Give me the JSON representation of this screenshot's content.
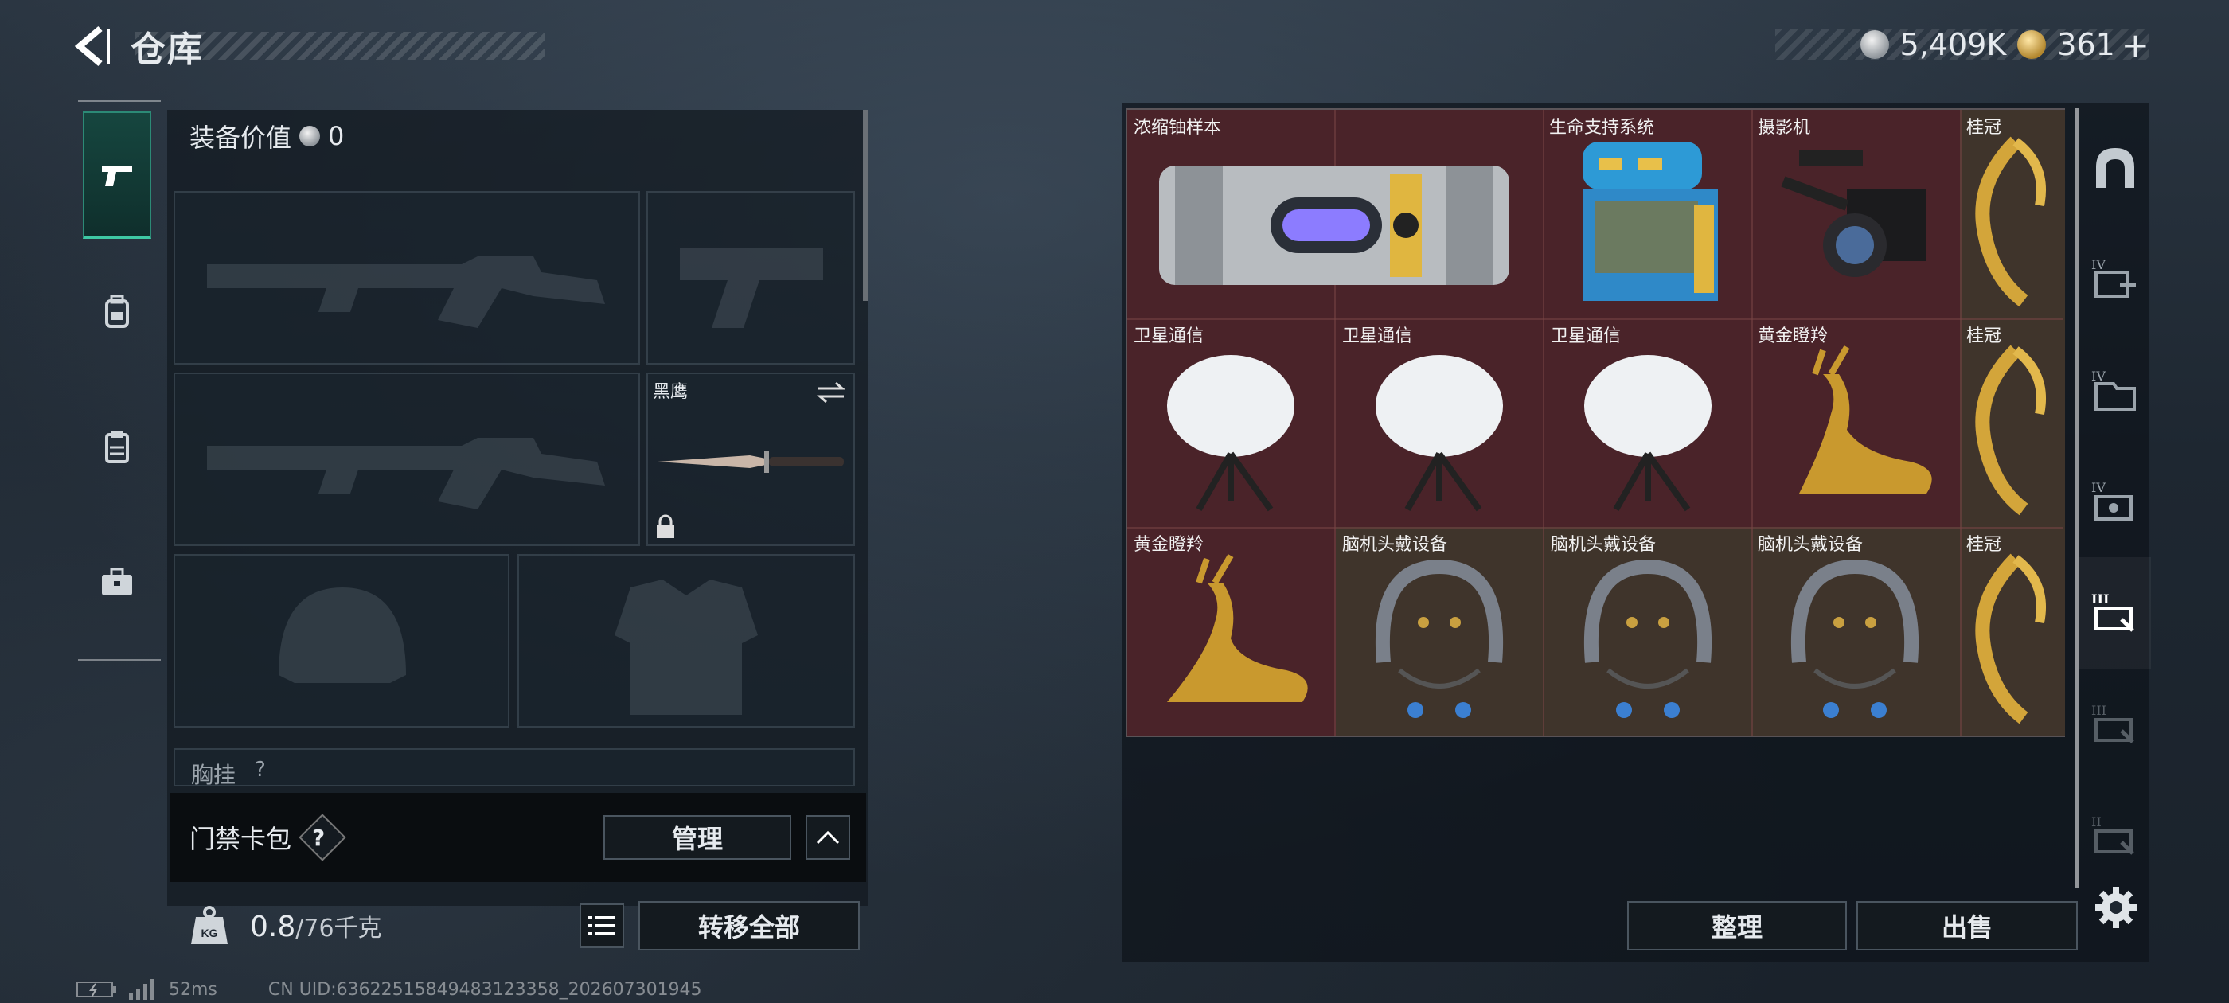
{
  "header": {
    "title": "仓库",
    "currency": [
      {
        "icon": "silver-coin-icon",
        "value": "5,409K"
      },
      {
        "icon": "gold-coin-icon",
        "value": "361"
      }
    ],
    "add_label": "+"
  },
  "left_nav": {
    "items": [
      {
        "icon": "pistol-icon",
        "active": true
      },
      {
        "icon": "backpack-icon",
        "active": false
      },
      {
        "icon": "clipboard-icon",
        "active": false
      },
      {
        "icon": "briefcase-icon",
        "active": false
      }
    ]
  },
  "loadout": {
    "equip_value_label": "装备价值",
    "equip_value": "0",
    "melee_label": "黑鹰",
    "chest_label": "胸挂",
    "chest_help": "?",
    "card_pack_label": "门禁卡包",
    "card_pack_help": "?",
    "manage_label": "管理",
    "weight_current": "0.8",
    "weight_max": "/76千克",
    "transfer_all_label": "转移全部"
  },
  "storage": {
    "items": [
      {
        "name": "浓缩铀样本",
        "rarity": "red"
      },
      {
        "name": "生命支持系统",
        "rarity": "red"
      },
      {
        "name": "摄影机",
        "rarity": "red"
      },
      {
        "name": "桂冠",
        "rarity": "brown"
      },
      {
        "name": "卫星通信",
        "rarity": "red"
      },
      {
        "name": "卫星通信",
        "rarity": "red"
      },
      {
        "name": "卫星通信",
        "rarity": "red"
      },
      {
        "name": "黄金瞪羚",
        "rarity": "red"
      },
      {
        "name": "桂冠",
        "rarity": "brown"
      },
      {
        "name": "黄金瞪羚",
        "rarity": "red"
      },
      {
        "name": "脑机头戴设备",
        "rarity": "brown"
      },
      {
        "name": "脑机头戴设备",
        "rarity": "brown"
      },
      {
        "name": "脑机头戴设备",
        "rarity": "brown"
      },
      {
        "name": "桂冠",
        "rarity": "brown"
      }
    ],
    "sort_label": "整理",
    "sell_label": "出售"
  },
  "side_tabs": [
    "IV",
    "IV",
    "IV",
    "III",
    "III",
    "II"
  ],
  "status": {
    "ping": "52ms",
    "uid": "CN UID:63622515849483123358_202607301945"
  },
  "colors": {
    "accent_green": "#3ec9a4",
    "cell_red": "#4a2329",
    "cell_brown": "#3f342b"
  }
}
